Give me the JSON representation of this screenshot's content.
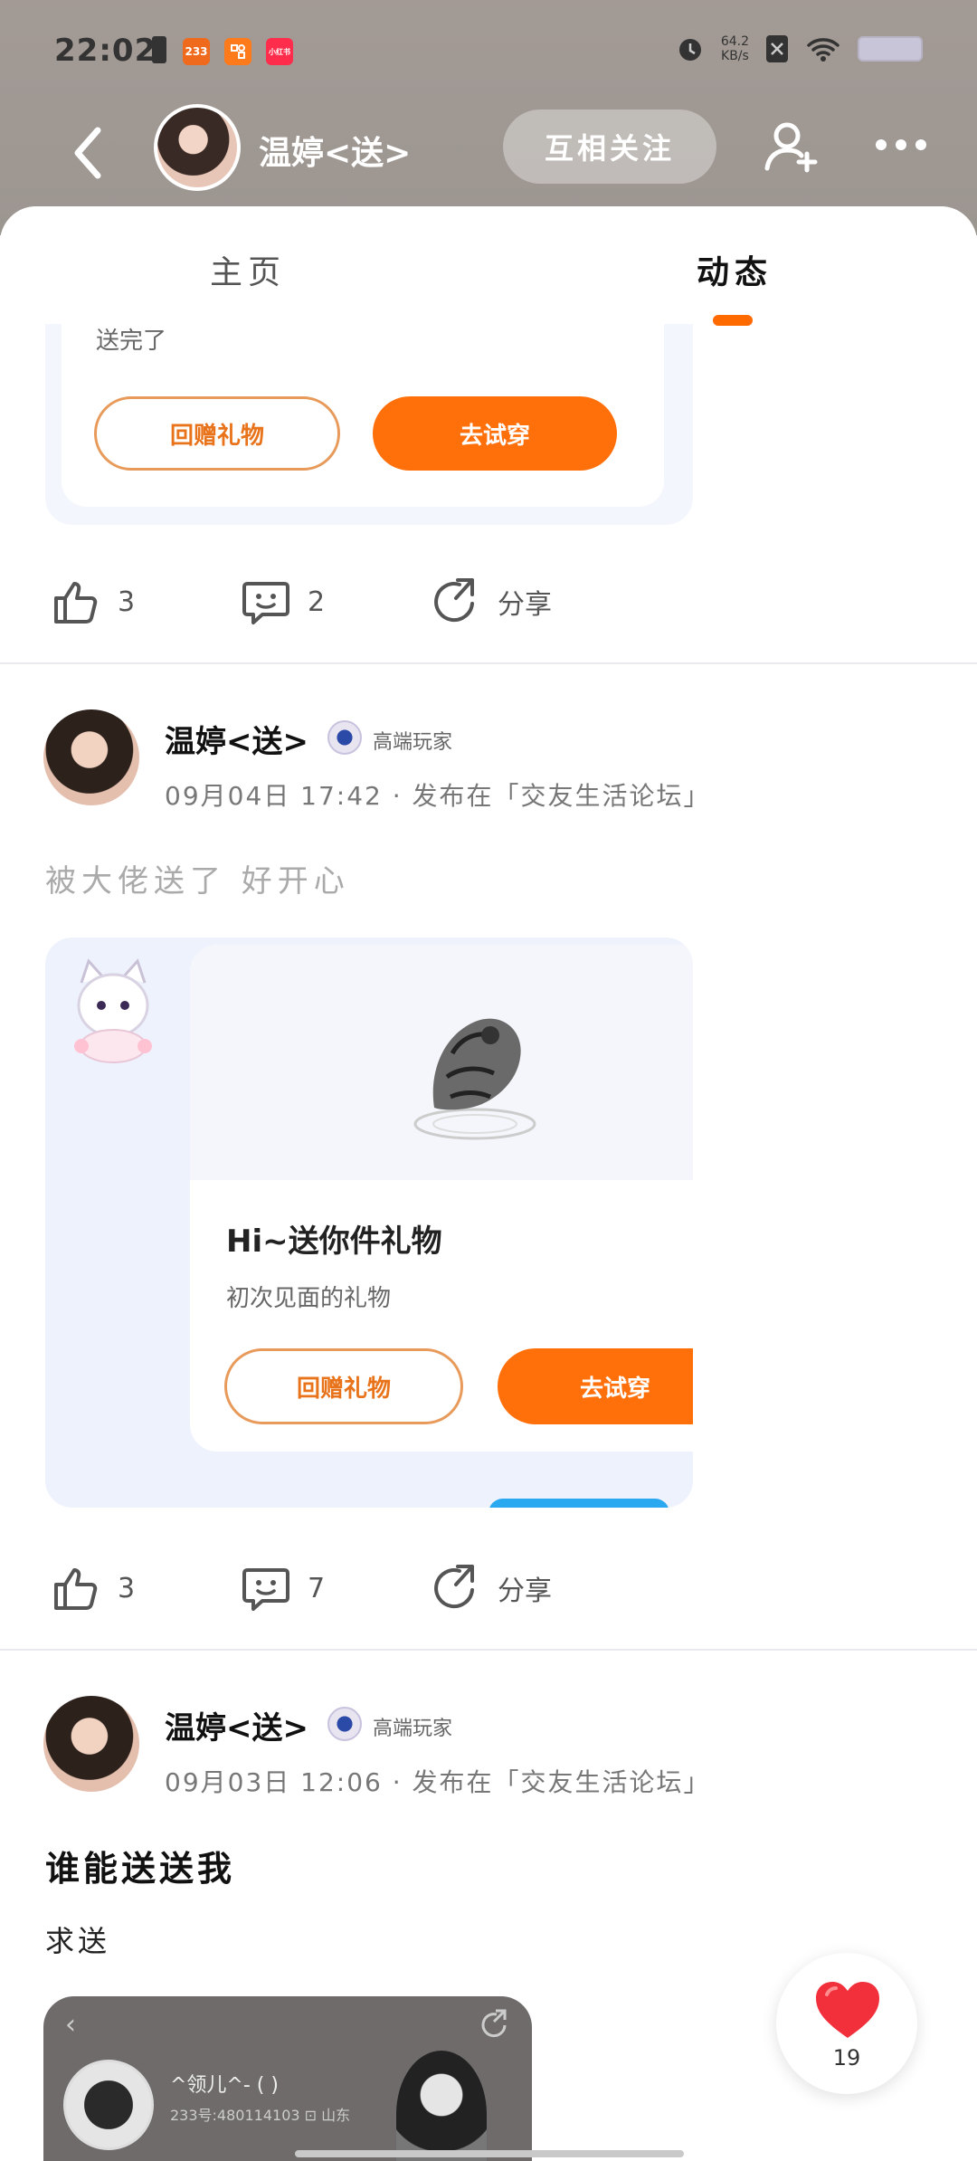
{
  "status_bar": {
    "time": "22:02",
    "badges": [
      "233",
      "",
      "小红书"
    ],
    "net_speed_value": "64.2",
    "net_speed_unit": "KB/s"
  },
  "nav": {
    "username": "温婷<送>",
    "follow_label": "互相关注"
  },
  "tabs": [
    {
      "label": "主页",
      "active": false
    },
    {
      "label": "动态",
      "active": true
    }
  ],
  "prev_card": {
    "text": "送完了",
    "return_gift": "回赠礼物",
    "try_on": "去试穿",
    "likes": "3",
    "comments": "2",
    "share": "分享"
  },
  "posts": [
    {
      "author": "温婷<送>",
      "level": "高端玩家",
      "meta": "09月04日 17:42 · 发布在「交友生活论坛」",
      "text": "被大佬送了 好开心",
      "gift_title": "Hi~送你件礼物",
      "gift_sub": "初次见面的礼物",
      "return_gift": "回赠礼物",
      "try_on": "去试穿",
      "likes": "3",
      "comments": "7",
      "share": "分享"
    },
    {
      "author": "温婷<送>",
      "level": "高端玩家",
      "meta": "09月03日 12:06 · 发布在「交友生活论坛」",
      "title": "谁能送送我",
      "body": "求送",
      "shot_name": "^领儿^- ( )",
      "shot_sub": "233号:480114103 ⊡ 山东"
    }
  ],
  "float_like": {
    "count": "19"
  },
  "colors": {
    "accent": "#ff6f0a",
    "outline": "#e89a5a"
  }
}
